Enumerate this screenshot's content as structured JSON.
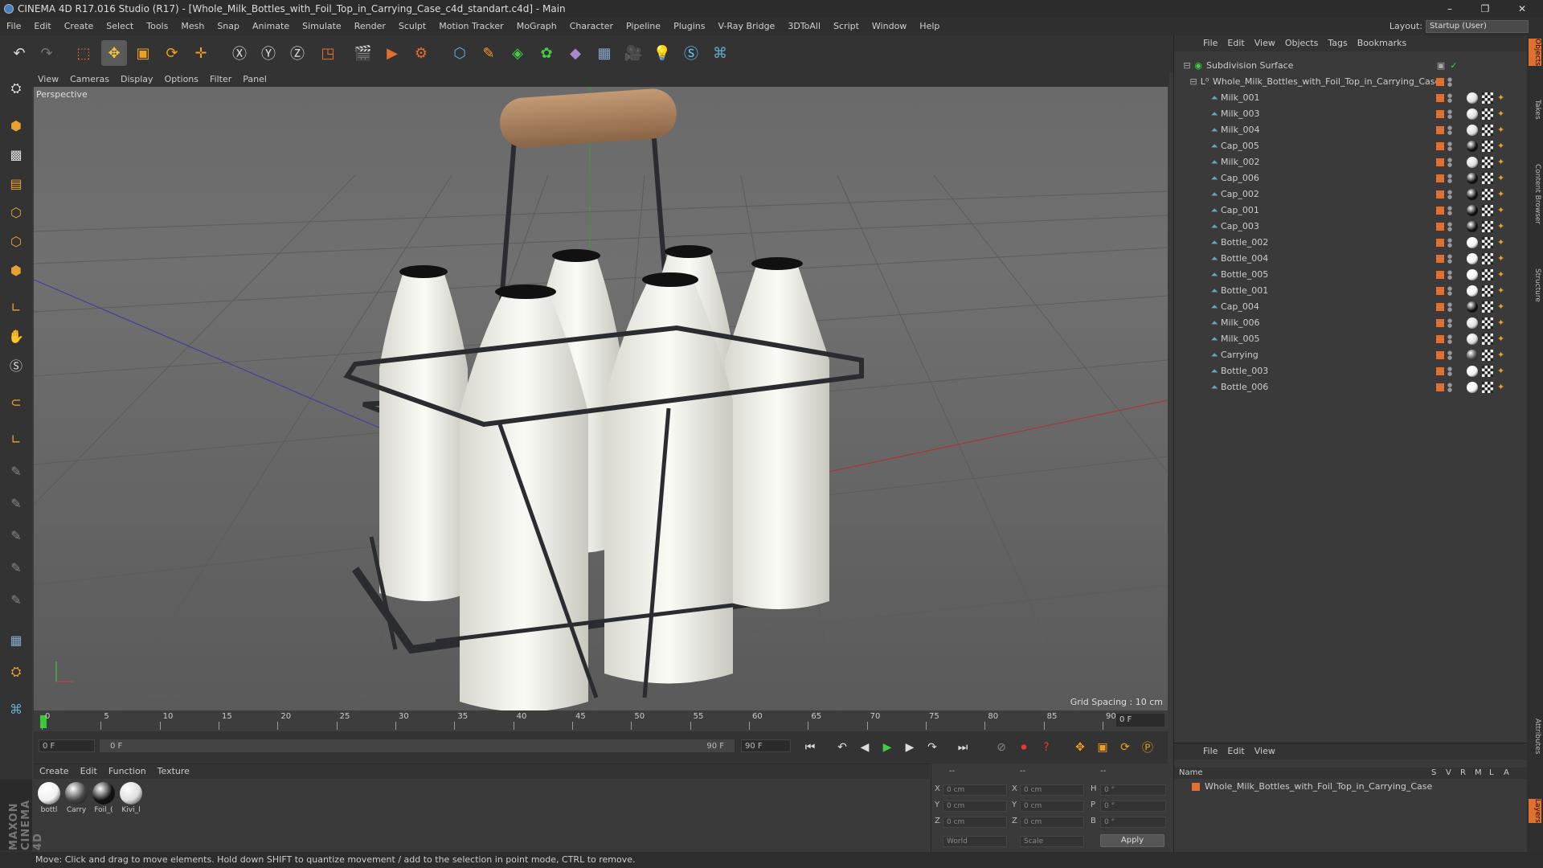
{
  "window": {
    "title": "CINEMA 4D R17.016 Studio (R17) - [Whole_Milk_Bottles_with_Foil_Top_in_Carrying_Case_c4d_standart.c4d] - Main",
    "min": "–",
    "max": "❐",
    "close": "✕"
  },
  "menu": [
    "File",
    "Edit",
    "Create",
    "Select",
    "Tools",
    "Mesh",
    "Snap",
    "Animate",
    "Simulate",
    "Render",
    "Sculpt",
    "Motion Tracker",
    "MoGraph",
    "Character",
    "Pipeline",
    "Plugins",
    "V-Ray Bridge",
    "3DToAll",
    "Script",
    "Window",
    "Help"
  ],
  "layout": {
    "label": "Layout:",
    "value": "Startup (User)"
  },
  "viewport": {
    "menu": [
      "View",
      "Cameras",
      "Display",
      "Options",
      "Filter",
      "Panel"
    ],
    "camera": "Perspective",
    "grid_spacing": "Grid Spacing : 10 cm"
  },
  "timeline": {
    "ticks": [
      "0",
      "5",
      "10",
      "15",
      "20",
      "25",
      "30",
      "35",
      "40",
      "45",
      "50",
      "55",
      "60",
      "65",
      "70",
      "75",
      "80",
      "85",
      "90"
    ],
    "current_frame": "0 F"
  },
  "transport": {
    "start": "0 F",
    "range_start": "0 F",
    "range_end": "90 F",
    "end": "90 F"
  },
  "materials": {
    "menu": [
      "Create",
      "Edit",
      "Function",
      "Texture"
    ],
    "items": [
      {
        "label": "bottl",
        "color": "#f0f0f0"
      },
      {
        "label": "Carry",
        "color": "#444"
      },
      {
        "label": "Foil_(",
        "color": "#111"
      },
      {
        "label": "Kivi_l",
        "color": "#ddd"
      }
    ]
  },
  "coords": {
    "header1": "--",
    "header2": "--",
    "header3": "--",
    "x_label": "X",
    "y_label": "Y",
    "z_label": "Z",
    "h_label": "H",
    "p_label": "P",
    "b_label": "B",
    "pos_x": "0 cm",
    "pos_y": "0 cm",
    "pos_z": "0 cm",
    "size_x": "0 cm",
    "size_y": "0 cm",
    "size_z": "0 cm",
    "rot_h": "0 °",
    "rot_p": "0 °",
    "rot_b": "0 °",
    "world": "World",
    "scale": "Scale",
    "apply": "Apply"
  },
  "status": "Move: Click and drag to move elements. Hold down SHIFT to quantize movement / add to the selection in point mode, CTRL to remove.",
  "objects": {
    "menu": [
      "File",
      "Edit",
      "View",
      "Objects",
      "Tags",
      "Bookmarks"
    ],
    "root": "Subdivision Surface",
    "group": "Whole_Milk_Bottles_with_Foil_Top_in_Carrying_Case",
    "items": [
      {
        "name": "Milk_001",
        "mat": "#ddd"
      },
      {
        "name": "Milk_003",
        "mat": "#ddd"
      },
      {
        "name": "Milk_004",
        "mat": "#ddd"
      },
      {
        "name": "Cap_005",
        "mat": "#111"
      },
      {
        "name": "Milk_002",
        "mat": "#ddd"
      },
      {
        "name": "Cap_006",
        "mat": "#111"
      },
      {
        "name": "Cap_002",
        "mat": "#111"
      },
      {
        "name": "Cap_001",
        "mat": "#111"
      },
      {
        "name": "Cap_003",
        "mat": "#111"
      },
      {
        "name": "Bottle_002",
        "mat": "#f4f4f4"
      },
      {
        "name": "Bottle_004",
        "mat": "#f4f4f4"
      },
      {
        "name": "Bottle_005",
        "mat": "#f4f4f4"
      },
      {
        "name": "Bottle_001",
        "mat": "#f4f4f4"
      },
      {
        "name": "Cap_004",
        "mat": "#111"
      },
      {
        "name": "Milk_006",
        "mat": "#ddd"
      },
      {
        "name": "Milk_005",
        "mat": "#ddd"
      },
      {
        "name": "Carrying",
        "mat": "#444"
      },
      {
        "name": "Bottle_003",
        "mat": "#f4f4f4"
      },
      {
        "name": "Bottle_006",
        "mat": "#f4f4f4"
      }
    ]
  },
  "layers": {
    "menu": [
      "File",
      "Edit",
      "View"
    ],
    "head_name": "Name",
    "head_cols": [
      "S",
      "V",
      "R",
      "M",
      "L",
      "A"
    ],
    "row": "Whole_Milk_Bottles_with_Foil_Top_in_Carrying_Case"
  },
  "right_tabs": [
    "Objects",
    "Takes",
    "Content Browser",
    "Structure",
    "Attributes",
    "Layers"
  ],
  "brand": "MAXON CINEMA 4D",
  "colors": {
    "accent": "#e07030",
    "viewport_bg": "#5f5f5f"
  }
}
